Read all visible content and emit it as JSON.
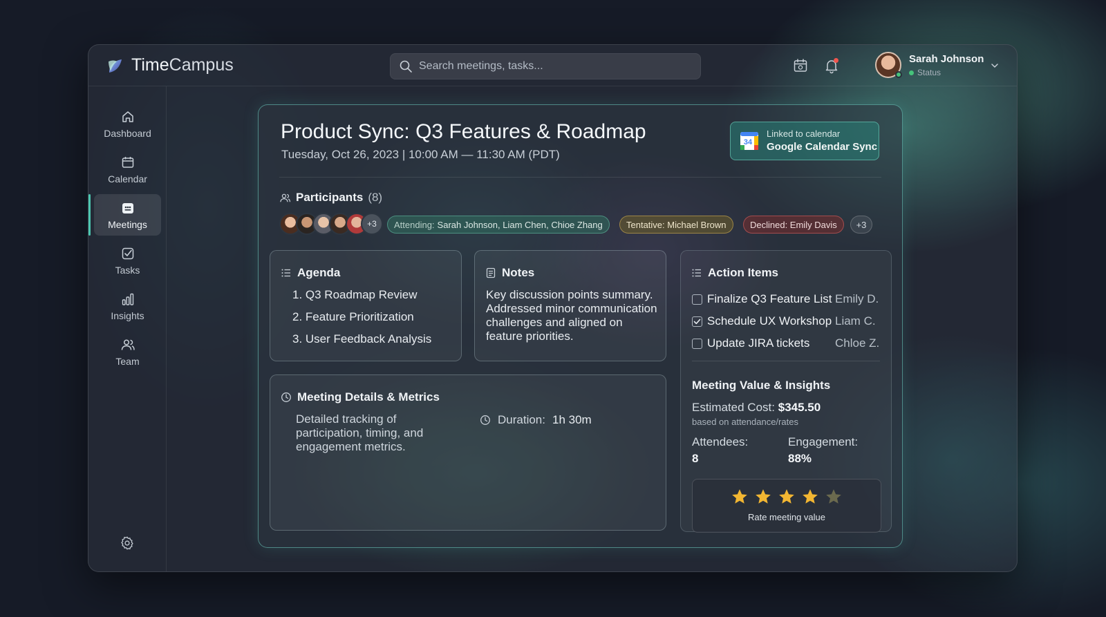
{
  "app": {
    "brand_main": "Time",
    "brand_rest": "Campus"
  },
  "search": {
    "placeholder": "Search meetings, tasks..."
  },
  "user": {
    "name": "Sarah Johnson",
    "status": "Status"
  },
  "sidebar": {
    "items": [
      {
        "label": "Dashboard",
        "icon": "home-icon"
      },
      {
        "label": "Calendar",
        "icon": "calendar-icon"
      },
      {
        "label": "Meetings",
        "icon": "meetings-icon",
        "active": true
      },
      {
        "label": "Tasks",
        "icon": "task-check-icon"
      },
      {
        "label": "Insights",
        "icon": "bar-chart-icon"
      },
      {
        "label": "Team",
        "icon": "team-icon"
      }
    ],
    "settings_icon": "gear-icon"
  },
  "meeting": {
    "title": "Product Sync: Q3 Features & Roadmap",
    "datetime": "Tuesday, Oct 26, 2023 | 10:00 AM — 11:30 AM (PDT)",
    "calendar_link": {
      "small": "Linked to calendar",
      "big": "Google Calendar Sync",
      "icon_day": "34"
    },
    "participants": {
      "label": "Participants",
      "count": "(8)",
      "avatar_more": "+3",
      "attending_label": "Attending:",
      "attending": "Sarah Johnson, Liam Chen, Chioe Zhang",
      "tentative": "Tentative: Michael Brown",
      "declined": "Declined: Emily Davis",
      "more": "+3"
    },
    "agenda": {
      "title": "Agenda",
      "items": [
        "1. Q3 Roadmap Review",
        "2. Feature Prioritization",
        "3. User Feedback Analysis"
      ]
    },
    "notes": {
      "title": "Notes",
      "text": "Key discussion points summary. Addressed minor communication challenges and aligned on feature priorities."
    },
    "details": {
      "title": "Meeting Details & Metrics",
      "text": "Detailed tracking of participation, timing, and engagement metrics.",
      "duration_label": "Duration:",
      "duration_value": "1h 30m"
    },
    "action_items": {
      "title": "Action Items",
      "items": [
        {
          "task": "Finalize Q3 Feature List",
          "owner": "Emily D.",
          "checked": false
        },
        {
          "task": "Schedule UX Workshop",
          "owner": "Liam C.",
          "checked": true
        },
        {
          "task": "Update JIRA tickets",
          "owner": "Chloe Z.",
          "checked": false
        }
      ]
    },
    "value": {
      "title": "Meeting Value & Insights",
      "cost_label": "Estimated Cost:",
      "cost_value": "$345.50",
      "cost_note": "based on attendance/rates",
      "attendees_label": "Attendees:",
      "attendees_value": "8",
      "engagement_label": "Engagement:",
      "engagement_value": "88%",
      "rating_stars": 4,
      "rating_max": 5,
      "rating_label": "Rate meeting value"
    }
  },
  "colors": {
    "accent": "#4cc7b0",
    "star_on": "#f2b632",
    "star_off": "#6b6a4e",
    "status_online": "#46c37b"
  }
}
